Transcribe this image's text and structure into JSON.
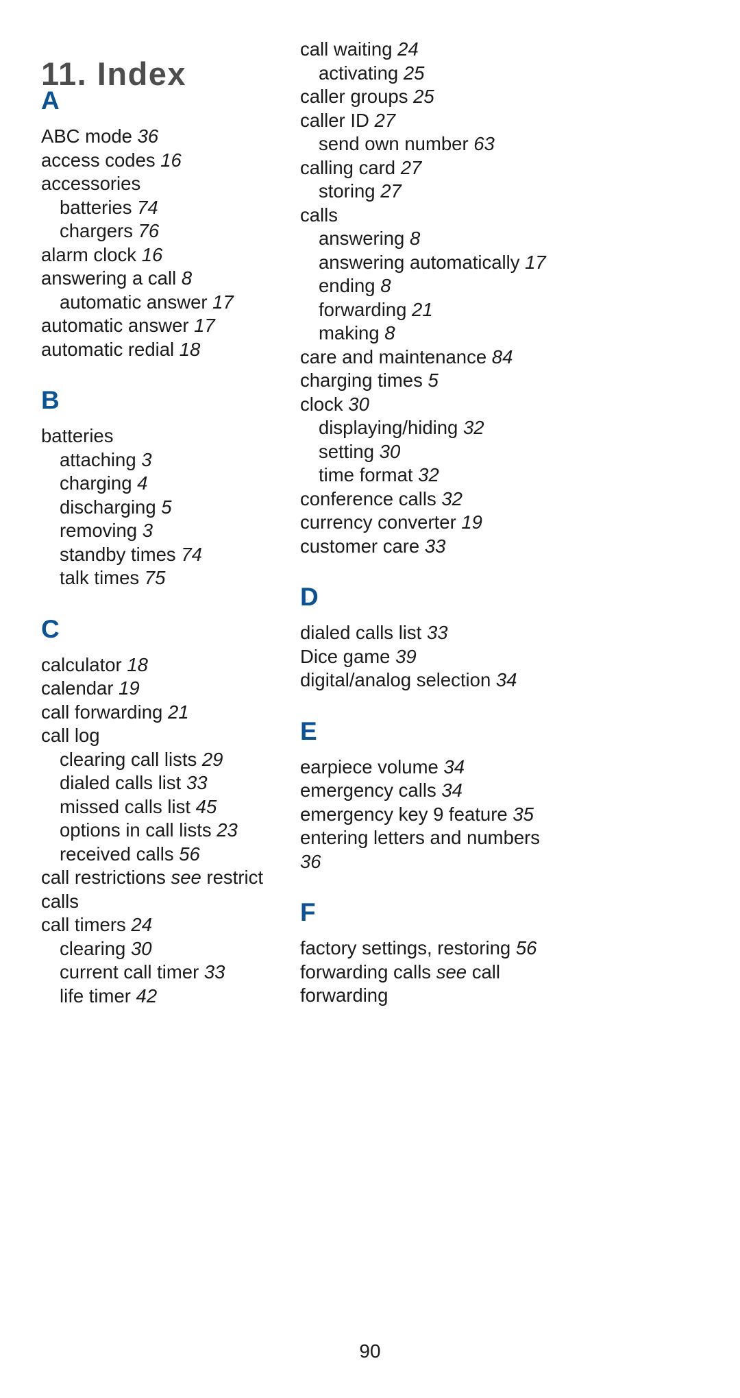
{
  "document": {
    "title": "11. Index",
    "page_number": "90",
    "accent_color": "#0b5394",
    "title_color": "#4d4d4d",
    "text_color": "#1a1a1a"
  },
  "columns": [
    {
      "name": "left-column",
      "sections": [
        {
          "letter": "A",
          "entries": [
            {
              "level": 0,
              "text": "ABC mode",
              "page": "36"
            },
            {
              "level": 0,
              "text": "access codes",
              "page": "16"
            },
            {
              "level": 0,
              "text": "accessories",
              "page": ""
            },
            {
              "level": 1,
              "text": "batteries",
              "page": "74"
            },
            {
              "level": 1,
              "text": "chargers",
              "page": "76"
            },
            {
              "level": 0,
              "text": "alarm clock",
              "page": "16"
            },
            {
              "level": 0,
              "text": "answering a call",
              "page": "8"
            },
            {
              "level": 1,
              "text": "automatic answer",
              "page": "17"
            },
            {
              "level": 0,
              "text": "automatic answer",
              "page": "17"
            },
            {
              "level": 0,
              "text": "automatic redial",
              "page": "18"
            }
          ]
        },
        {
          "letter": "B",
          "entries": [
            {
              "level": 0,
              "text": "batteries",
              "page": ""
            },
            {
              "level": 1,
              "text": "attaching",
              "page": "3"
            },
            {
              "level": 1,
              "text": "charging",
              "page": "4"
            },
            {
              "level": 1,
              "text": "discharging",
              "page": "5"
            },
            {
              "level": 1,
              "text": "removing",
              "page": "3"
            },
            {
              "level": 1,
              "text": "standby times",
              "page": "74"
            },
            {
              "level": 1,
              "text": "talk times",
              "page": "75"
            }
          ]
        },
        {
          "letter": "C",
          "entries": [
            {
              "level": 0,
              "text": "calculator",
              "page": "18"
            },
            {
              "level": 0,
              "text": "calendar",
              "page": "19"
            },
            {
              "level": 0,
              "text": "call forwarding",
              "page": "21"
            },
            {
              "level": 0,
              "text": "call log",
              "page": ""
            },
            {
              "level": 1,
              "text": "clearing call lists",
              "page": "29"
            },
            {
              "level": 1,
              "text": "dialed calls list",
              "page": "33"
            },
            {
              "level": 1,
              "text": "missed calls list",
              "page": "45"
            },
            {
              "level": 1,
              "text": "options in call lists",
              "page": "23"
            },
            {
              "level": 1,
              "text": "received calls",
              "page": "56"
            },
            {
              "level": 0,
              "text": "call restrictions",
              "xref": "see",
              "xref_target": "restrict calls",
              "page": ""
            },
            {
              "level": 0,
              "text": "call timers",
              "page": "24"
            },
            {
              "level": 1,
              "text": "clearing",
              "page": "30"
            },
            {
              "level": 1,
              "text": "current call timer",
              "page": "33"
            },
            {
              "level": 1,
              "text": "life timer",
              "page": "42"
            }
          ]
        }
      ]
    },
    {
      "name": "right-column",
      "sections": [
        {
          "letter": "",
          "entries": [
            {
              "level": 0,
              "text": "call waiting",
              "page": "24"
            },
            {
              "level": 1,
              "text": "activating",
              "page": "25"
            },
            {
              "level": 0,
              "text": "caller groups",
              "page": "25"
            },
            {
              "level": 0,
              "text": "caller ID",
              "page": "27"
            },
            {
              "level": 1,
              "text": "send own number",
              "page": "63"
            },
            {
              "level": 0,
              "text": "calling card",
              "page": "27"
            },
            {
              "level": 1,
              "text": "storing",
              "page": "27"
            },
            {
              "level": 0,
              "text": "calls",
              "page": ""
            },
            {
              "level": 1,
              "text": "answering",
              "page": "8"
            },
            {
              "level": 1,
              "text": "answering automatically",
              "page": "17"
            },
            {
              "level": 1,
              "text": "ending",
              "page": "8"
            },
            {
              "level": 1,
              "text": "forwarding",
              "page": "21"
            },
            {
              "level": 1,
              "text": "making",
              "page": "8"
            },
            {
              "level": 0,
              "text": "care and maintenance",
              "page": "84"
            },
            {
              "level": 0,
              "text": "charging times",
              "page": "5"
            },
            {
              "level": 0,
              "text": "clock",
              "page": "30"
            },
            {
              "level": 1,
              "text": "displaying/hiding",
              "page": "32"
            },
            {
              "level": 1,
              "text": "setting",
              "page": "30"
            },
            {
              "level": 1,
              "text": "time format",
              "page": "32"
            },
            {
              "level": 0,
              "text": "conference calls",
              "page": "32"
            },
            {
              "level": 0,
              "text": "currency converter",
              "page": "19"
            },
            {
              "level": 0,
              "text": "customer care",
              "page": "33"
            }
          ]
        },
        {
          "letter": "D",
          "entries": [
            {
              "level": 0,
              "text": "dialed calls list",
              "page": "33"
            },
            {
              "level": 0,
              "text": "Dice game",
              "page": "39"
            },
            {
              "level": 0,
              "text": "digital/analog selection",
              "page": "34"
            }
          ]
        },
        {
          "letter": "E",
          "entries": [
            {
              "level": 0,
              "text": "earpiece volume",
              "page": "34"
            },
            {
              "level": 0,
              "text": "emergency calls",
              "page": "34"
            },
            {
              "level": 0,
              "text": "emergency key 9 feature",
              "page": "35"
            },
            {
              "level": 0,
              "text": "entering letters and numbers",
              "page": "36"
            }
          ]
        },
        {
          "letter": "F",
          "entries": [
            {
              "level": 0,
              "text": "factory settings, restoring",
              "page": "56"
            },
            {
              "level": 0,
              "text": "forwarding calls",
              "xref": "see",
              "xref_target": "call forwarding",
              "page": ""
            }
          ]
        }
      ]
    }
  ]
}
